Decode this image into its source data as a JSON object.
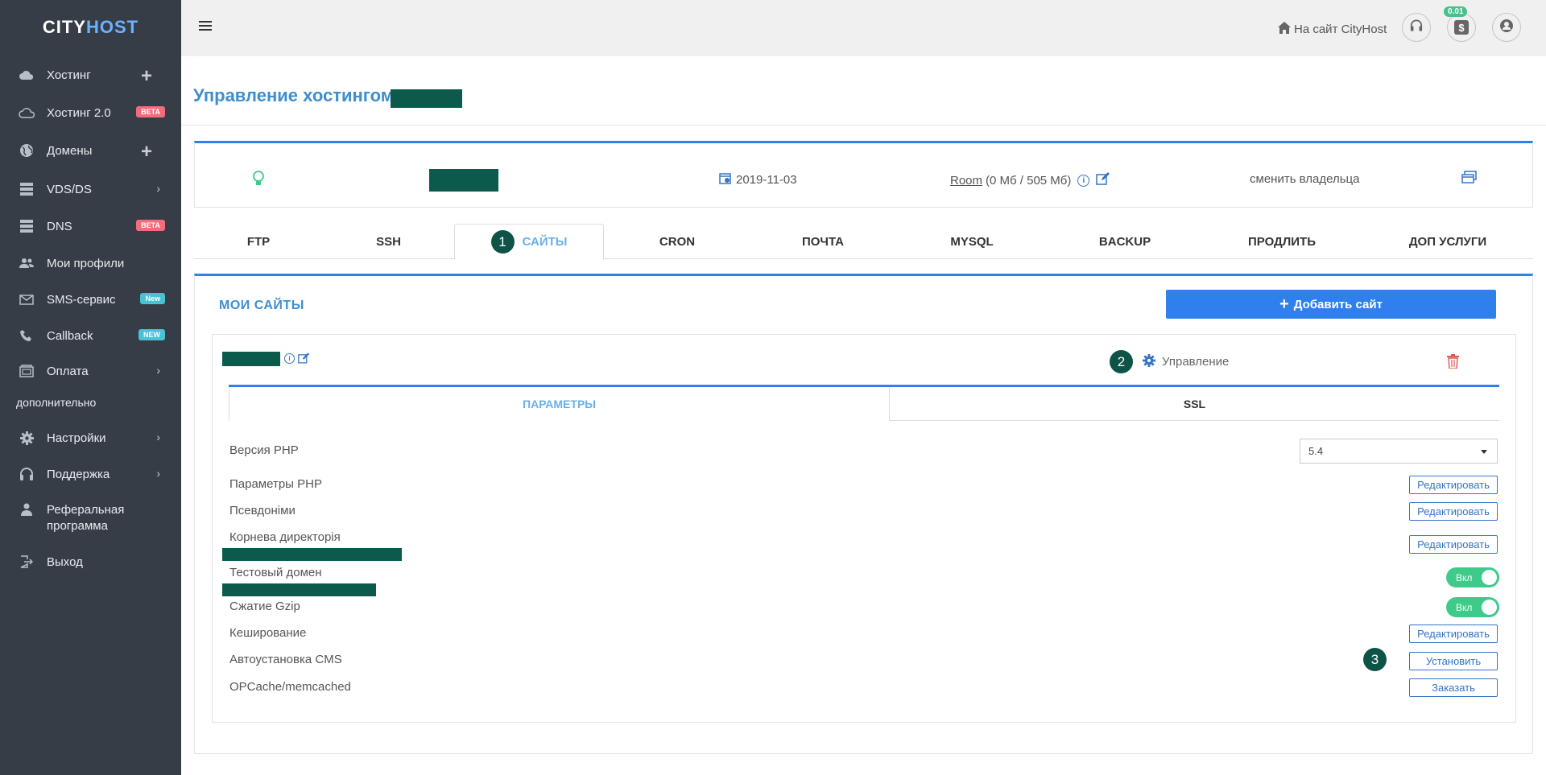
{
  "sidebar": {
    "brand_left": "CITY",
    "brand_right": "HOST",
    "items": [
      {
        "label": "Хостинг"
      },
      {
        "label": "Хостинг 2.0",
        "badge": "BETA"
      },
      {
        "label": "Домены"
      },
      {
        "label": "VDS/DS"
      },
      {
        "label": "DNS",
        "badge": "BETA"
      },
      {
        "label": "Мои профили"
      },
      {
        "label": "SMS-сервис",
        "badge": "New"
      },
      {
        "label": "Callback",
        "badge": "NEW"
      },
      {
        "label": "Оплата"
      },
      {
        "label": "Настройки"
      },
      {
        "label": "Поддержка"
      },
      {
        "label": "Реферальная программа"
      },
      {
        "label": "Выход"
      }
    ],
    "section_label": "дополнительно"
  },
  "topbar": {
    "site_link": "На сайт CityHost",
    "balance": "0.01"
  },
  "page": {
    "title": "Управление хостингом"
  },
  "info": {
    "date": "2019-11-03",
    "room_label": "Room",
    "room_usage": "(0 Мб / 505 Мб)",
    "change_owner": "сменить владельца"
  },
  "tabs": [
    {
      "label": "FTP"
    },
    {
      "label": "SSH"
    },
    {
      "label": "САЙТЫ",
      "step": "1"
    },
    {
      "label": "CRON"
    },
    {
      "label": "ПОЧТА"
    },
    {
      "label": "MYSQL"
    },
    {
      "label": "BACKUP"
    },
    {
      "label": "ПРОДЛИТЬ"
    },
    {
      "label": "ДОП УСЛУГИ"
    }
  ],
  "sites": {
    "heading": "МОИ САЙТЫ",
    "add_button": "Добавить сайт",
    "manage_step": "2",
    "manage_label": "Управление",
    "subtabs": [
      {
        "label": "ПАРАМЕТРЫ"
      },
      {
        "label": "SSL"
      }
    ],
    "php_version_label": "Версия PHP",
    "php_version_value": "5.4",
    "rows": [
      {
        "label": "Параметры PHP",
        "action": "Редактировать"
      },
      {
        "label": "Псевдоніми",
        "action": "Редактировать"
      },
      {
        "label": "Корнева директорія",
        "action": "Редактировать"
      },
      {
        "label": "Тестовый домен",
        "toggle": "Вкл"
      },
      {
        "label": "Сжатие Gzip",
        "toggle": "Вкл"
      },
      {
        "label": "Кеширование",
        "action": "Редактировать"
      },
      {
        "label": "Автоустановка CMS",
        "action": "Установить",
        "step": "3"
      },
      {
        "label": "OPCache/memcached",
        "action": "Заказать"
      }
    ]
  },
  "colors": {
    "sidebar_bg": "#373d47",
    "accent": "#2f80ed",
    "step_badge": "#0d5346",
    "toggle_on": "#3ecb8a",
    "danger": "#e25858"
  }
}
